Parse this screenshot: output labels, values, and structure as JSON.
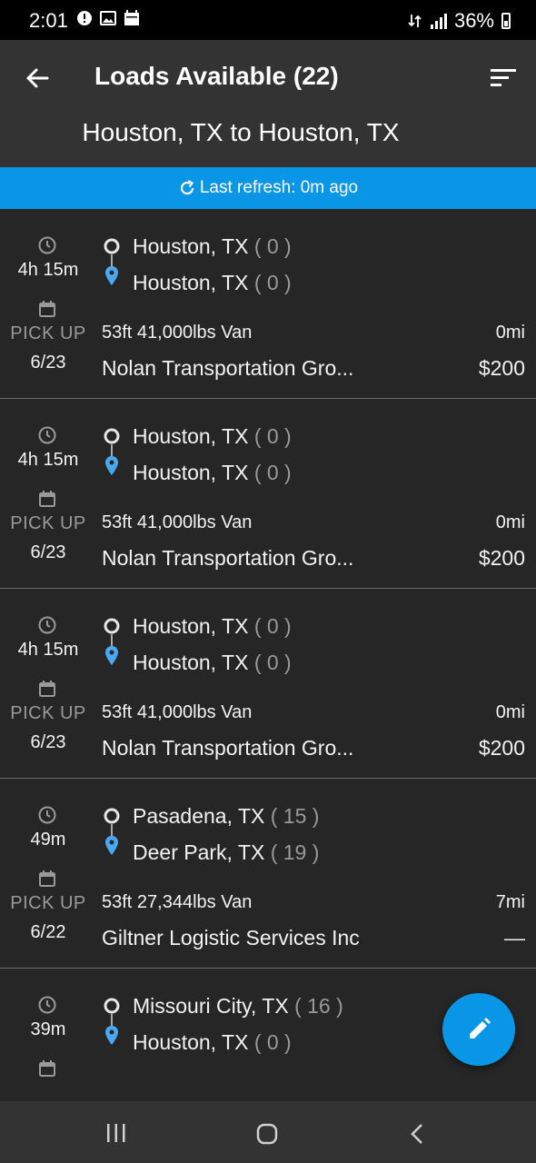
{
  "status_bar": {
    "time": "2:01",
    "battery": "36%",
    "icons": [
      "alert-icon",
      "image-icon",
      "calendar-icon",
      "data-icon",
      "signal-icon",
      "battery-icon"
    ]
  },
  "header": {
    "title": "Loads Available (22)",
    "route": "Houston, TX to Houston, TX",
    "back_icon": "arrow-left-icon",
    "sort_icon": "sort-icon"
  },
  "refresh": {
    "text": "Last refresh: 0m ago",
    "icon": "refresh-icon"
  },
  "loads": [
    {
      "duration": "4h 15m",
      "pickup_label": "PICK UP",
      "pickup_date": "6/23",
      "origin": "Houston, TX",
      "origin_count": "( 0 )",
      "dest": "Houston, TX",
      "dest_count": "( 0 )",
      "equipment": "53ft 41,000lbs Van",
      "miles": "0mi",
      "company": "Nolan Transportation Gro...",
      "price": "$200"
    },
    {
      "duration": "4h 15m",
      "pickup_label": "PICK UP",
      "pickup_date": "6/23",
      "origin": "Houston, TX",
      "origin_count": "( 0 )",
      "dest": "Houston, TX",
      "dest_count": "( 0 )",
      "equipment": "53ft 41,000lbs Van",
      "miles": "0mi",
      "company": "Nolan Transportation Gro...",
      "price": "$200"
    },
    {
      "duration": "4h 15m",
      "pickup_label": "PICK UP",
      "pickup_date": "6/23",
      "origin": "Houston, TX",
      "origin_count": "( 0 )",
      "dest": "Houston, TX",
      "dest_count": "( 0 )",
      "equipment": "53ft 41,000lbs Van",
      "miles": "0mi",
      "company": "Nolan Transportation Gro...",
      "price": "$200"
    },
    {
      "duration": "49m",
      "pickup_label": "PICK UP",
      "pickup_date": "6/22",
      "origin": "Pasadena, TX",
      "origin_count": "( 15 )",
      "dest": "Deer Park, TX",
      "dest_count": "( 19 )",
      "equipment": "53ft 27,344lbs Van",
      "miles": "7mi",
      "company": "Giltner Logistic Services Inc",
      "price": "—"
    },
    {
      "duration": "39m",
      "origin": "Missouri City, TX",
      "origin_count": "( 16 )",
      "dest": "Houston, TX",
      "dest_count": "( 0 )"
    }
  ],
  "fab": {
    "icon": "pencil-icon"
  },
  "colors": {
    "accent": "#0a96e6",
    "background": "#262626",
    "header": "#333333",
    "pin": "#4aa8f0"
  }
}
